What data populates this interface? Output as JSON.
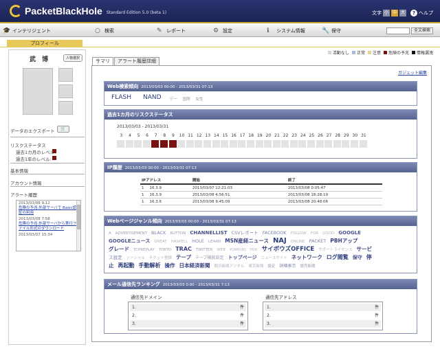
{
  "header": {
    "logo": "PacketBlackHole",
    "edition": "Standard Edition 5.0 (beta 1)",
    "font_label": "文字",
    "font_sizes": [
      "小",
      "中",
      "大"
    ],
    "help": "ヘルプ"
  },
  "nav": {
    "items": [
      "インテリジェント",
      "検索",
      "レポート",
      "設定",
      "システム情報",
      "保守"
    ],
    "search_button": "全文検索"
  },
  "subtab": "プロフィール",
  "profile": {
    "name": "武　博",
    "switch_button": "人物選択",
    "export_label": "データのエクスポート",
    "risk_title": "リスクステータス",
    "risk_1m": "過去1カ月のレベル:",
    "risk_1y": "過去1年のレベル:",
    "links": [
      "基本情報",
      "アカウント情報",
      "アラート履歴"
    ],
    "alerts": [
      {
        "date": "2013/03/08  9:12",
        "text": "危険の予兆:外部サーバで Basic認証の利用"
      },
      {
        "date": "2013/03/08  7:58",
        "text": "危険の予兆:外部サーバから実行ファイル形式のダウンロード"
      },
      {
        "date": "2013/03/07  15:34",
        "text": ""
      }
    ]
  },
  "legend": {
    "items": [
      {
        "label": "活動なし",
        "color": "#d8d8d8"
      },
      {
        "label": "正常",
        "color": "#a9bcd8"
      },
      {
        "label": "注意",
        "color": "#e8d690"
      },
      {
        "label": "危険の予兆",
        "color": "#7a1010"
      },
      {
        "label": "情報漏洩",
        "color": "#111111"
      }
    ]
  },
  "tabs": [
    "サマリ",
    "アラート履歴詳細"
  ],
  "gadget_edit": "ガジェット編集",
  "panels": {
    "web_search": {
      "title": "Web検索傾向",
      "range": "2013/03/03 00:00 - 2013/03/31 07:13",
      "keywords": [
        {
          "t": "FLASH",
          "c": "#2a3b7a",
          "s": 9
        },
        {
          "t": "NAND",
          "c": "#2a3b7a",
          "s": 9
        },
        {
          "t": "デー",
          "c": "#999",
          "s": 5.5
        },
        {
          "t": "国際",
          "c": "#999",
          "s": 5.5
        },
        {
          "t": "女性",
          "c": "#999",
          "s": 5.5
        }
      ]
    },
    "risk": {
      "title": "過去1カ月のリスクステータス",
      "range": "2013/03/03 - 2013/03/31",
      "days": [
        "3",
        "4",
        "5",
        "6",
        "7",
        "8",
        "9",
        "10",
        "11",
        "12",
        "13",
        "14",
        "15",
        "16",
        "17",
        "18",
        "19",
        "20",
        "21",
        "22",
        "23",
        "24",
        "25",
        "26",
        "27",
        "28",
        "29",
        "30",
        "31"
      ],
      "high_days": [
        "7",
        "8",
        "9"
      ]
    },
    "ip": {
      "title": "IP履歴",
      "range": "2013/03/03 00:00 - 2013/03/31 07:13",
      "columns": [
        "IPアドレス",
        "開始",
        "終了"
      ],
      "rows": [
        [
          "1",
          "16.3.9",
          "2013/03/07 12:21:03",
          "2013/03/08 0:05:47"
        ],
        [
          "1",
          "16.3.9",
          "2013/03/08 4:56:51",
          "2013/03/08 18:28:19"
        ],
        [
          "1",
          "16.3.6",
          "2013/03/08 9:45:09",
          "2013/03/08 20:48:06"
        ]
      ]
    },
    "genre": {
      "title": "Webページジャンル傾向",
      "range": "2013/03/03 00:00 - 2013/03/31 07:13",
      "lines": [
        [
          {
            "t": "A",
            "c": "#9a9ab0",
            "s": 5.5
          },
          {
            "t": "ADVERTISEMENT",
            "c": "#9a9ab0",
            "s": 5.5
          },
          {
            "t": "BLACK",
            "c": "#7a80a8",
            "s": 6.5
          },
          {
            "t": "BUTTON",
            "c": "#9a9ab0",
            "s": 5.5
          },
          {
            "t": "CHANNELLIST",
            "c": "#4a5290",
            "s": 7
          },
          {
            "t": "CSVレポート",
            "c": "#7a80a8",
            "s": 6.5
          },
          {
            "t": "FACEBOOK",
            "c": "#7a80a8",
            "s": 6.5
          },
          {
            "t": "FOLLOW",
            "c": "#b0b0c0",
            "s": 5.5
          },
          {
            "t": "FOR",
            "c": "#b0b0c0",
            "s": 5.5
          },
          {
            "t": "GOOD",
            "c": "#b0b0c0",
            "s": 5.5
          },
          {
            "t": "GOOGLE",
            "c": "#4a5290",
            "s": 7
          }
        ],
        [
          {
            "t": "GOOGLEニュース",
            "c": "#4a5290",
            "s": 7
          },
          {
            "t": "GREAT",
            "c": "#b0b0c0",
            "s": 5.5
          },
          {
            "t": "HASKELL",
            "c": "#b0b0c0",
            "s": 5.5
          },
          {
            "t": "HOLE",
            "c": "#7a80a8",
            "s": 6.5
          },
          {
            "t": "LEARN",
            "c": "#9a9ab0",
            "s": 5.5
          },
          {
            "t": "MSN産経ニュース",
            "c": "#3a4282",
            "s": 7.5
          },
          {
            "t": "NAJ",
            "c": "#2a3b7a",
            "s": 10
          },
          {
            "t": "ONLINE",
            "c": "#b0b0c0",
            "s": 5.5
          },
          {
            "t": "PACKET",
            "c": "#7a80a8",
            "s": 6.5
          },
          {
            "t": "PBHアップ",
            "c": "#3a4282",
            "s": 7.5
          }
        ],
        [
          {
            "t": "グレード",
            "c": "#3a4282",
            "s": 7.5
          },
          {
            "t": "TCPREPLAY",
            "c": "#9a9ab0",
            "s": 5.5
          },
          {
            "t": "TOKYO",
            "c": "#9a9ab0",
            "s": 5.5
          },
          {
            "t": "TRAC",
            "c": "#3a4282",
            "s": 8
          },
          {
            "t": "TWITTER",
            "c": "#9a9ab0",
            "s": 5.5
          },
          {
            "t": "WEB",
            "c": "#b0b0c0",
            "s": 5.5
          },
          {
            "t": "YOMIURI",
            "c": "#b0b0c0",
            "s": 5.5
          },
          {
            "t": "YOU",
            "c": "#b0b0c0",
            "s": 5.5
          },
          {
            "t": "サイボウズOFFICE",
            "c": "#2a3b7a",
            "s": 8.5
          },
          {
            "t": "サポートライセンス",
            "c": "#b0b0c0",
            "s": 5.5
          },
          {
            "t": "サービ",
            "c": "#3a4282",
            "s": 7.5
          }
        ],
        [
          {
            "t": "ス設定",
            "c": "#7a80a8",
            "s": 6.5
          },
          {
            "t": "ソーシャル",
            "c": "#b0b0c0",
            "s": 5.5
          },
          {
            "t": "チケット登録",
            "c": "#b0b0c0",
            "s": 5.5
          },
          {
            "t": "テープ",
            "c": "#3a4282",
            "s": 7.5
          },
          {
            "t": "テープ機能設定",
            "c": "#9a9ab0",
            "s": 6
          },
          {
            "t": "トップページ",
            "c": "#4a5290",
            "s": 7
          },
          {
            "t": "ニュースサイト",
            "c": "#b0b0c0",
            "s": 5.5
          },
          {
            "t": "ネットワーク",
            "c": "#3a4282",
            "s": 7.5
          },
          {
            "t": "ログ閲覧",
            "c": "#2a3b7a",
            "s": 8
          },
          {
            "t": "保守",
            "c": "#4a5290",
            "s": 7
          },
          {
            "t": "停",
            "c": "#3a4282",
            "s": 8
          }
        ],
        [
          {
            "t": "止",
            "c": "#3a4282",
            "s": 7.5
          },
          {
            "t": "再起動",
            "c": "#2a3b7a",
            "s": 8
          },
          {
            "t": "手動解析",
            "c": "#2a3b7a",
            "s": 8
          },
          {
            "t": "操作",
            "c": "#3a4282",
            "s": 7.5
          },
          {
            "t": "日本経済新聞",
            "c": "#3a4282",
            "s": 7.5
          },
          {
            "t": "朝日新聞デジタル",
            "c": "#b0b0c0",
            "s": 5.5
          },
          {
            "t": "東京新聞",
            "c": "#b0b0c0",
            "s": 5.5
          },
          {
            "t": "設定",
            "c": "#9a9ab0",
            "s": 5.5
          },
          {
            "t": "詳細表示",
            "c": "#7a80a8",
            "s": 6
          },
          {
            "t": "読売新聞",
            "c": "#9a9ab0",
            "s": 5.5
          }
        ]
      ]
    },
    "mail": {
      "title": "メール通信先ランキング",
      "range": "2013/03/03 0:00 - 2013/03/31 7:13",
      "domain_header": "通信先ドメイン",
      "address_header": "通信先アドレス",
      "rows": [
        {
          "rank": "1.",
          "unit": "件"
        },
        {
          "rank": "2.",
          "unit": "件"
        },
        {
          "rank": "3.",
          "unit": "件"
        }
      ]
    }
  }
}
